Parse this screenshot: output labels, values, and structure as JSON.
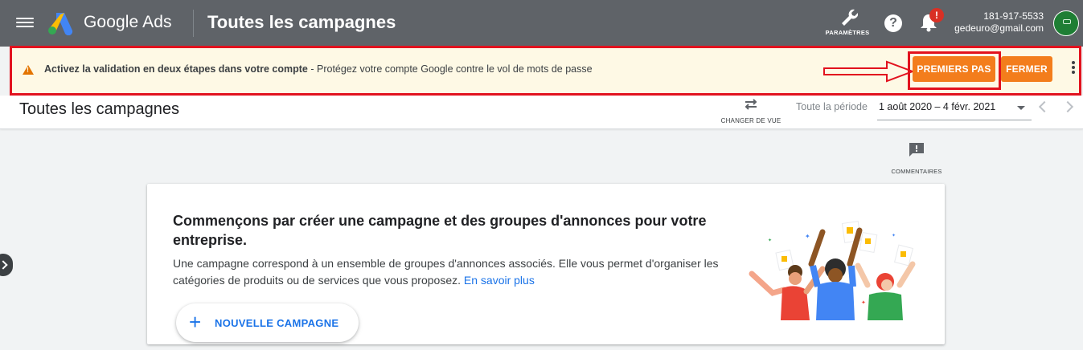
{
  "topbar": {
    "brand": "Google Ads",
    "title": "Toutes les campagnes",
    "tools_label": "PARAMÈTRES",
    "help_symbol": "?",
    "notification_badge": "!",
    "account_id": "181-917-5533",
    "account_email": "gedeuro@gmail.com"
  },
  "banner": {
    "bold_text": "Activez la validation en deux étapes dans votre compte",
    "text": " - Protégez votre compte Google contre le vol de mots de passe",
    "primary_button": "PREMIERS PAS",
    "dismiss_button": "FERMER"
  },
  "header": {
    "title": "Toutes les campagnes",
    "change_view_label": "CHANGER DE VUE",
    "period_label": "Toute la période",
    "date_range": "1 août 2020 – 4 févr. 2021"
  },
  "feedback": {
    "label": "COMMENTAIRES"
  },
  "card": {
    "title": "Commençons par créer une campagne et des groupes d'annonces pour votre entreprise.",
    "description": "Une campagne correspond à un ensemble de groupes d'annonces associés. Elle vous permet d'organiser les catégories de produits ou de services que vous proposez. ",
    "link": "En savoir plus",
    "cta_plus": "+",
    "cta_label": "NOUVELLE CAMPAGNE"
  },
  "colors": {
    "topbar": "#5f6368",
    "banner_bg": "#fef9e5",
    "annotation_red": "#e2121e",
    "orange_button": "#f37d1c",
    "link_blue": "#1a73e8"
  }
}
